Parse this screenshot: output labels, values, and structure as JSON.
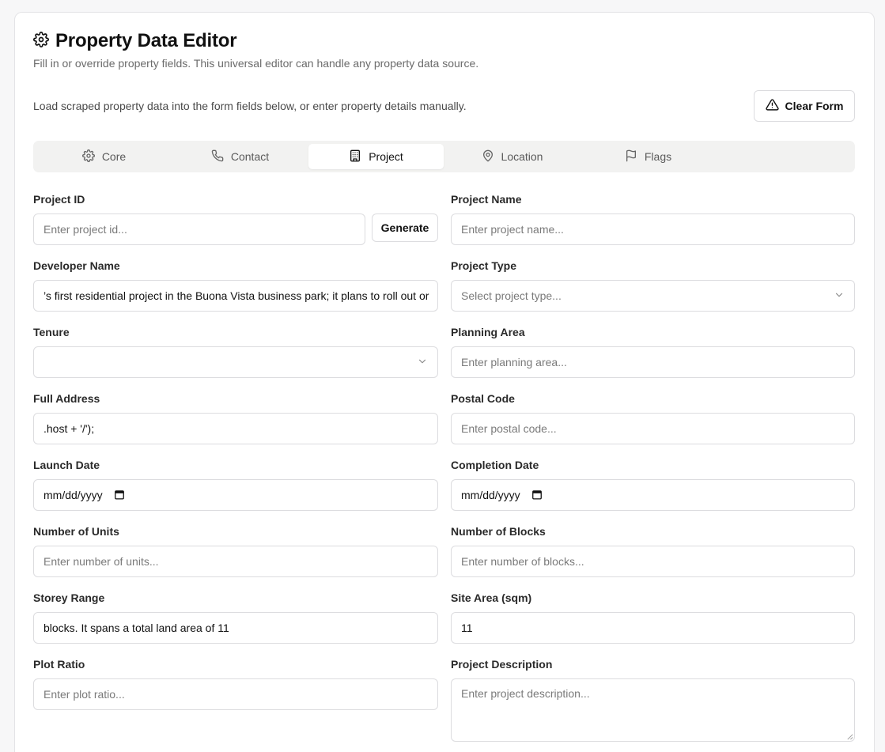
{
  "header": {
    "title": "Property Data Editor",
    "subtitle": "Fill in or override property fields. This universal editor can handle any property data source.",
    "load_text": "Load scraped property data into the form fields below, or enter property details manually.",
    "clear_label": "Clear Form"
  },
  "tabs": [
    {
      "label": "Core",
      "icon": "gear-icon",
      "active": false
    },
    {
      "label": "Contact",
      "icon": "phone-icon",
      "active": false
    },
    {
      "label": "Project",
      "icon": "building-icon",
      "active": true
    },
    {
      "label": "Location",
      "icon": "map-pin-icon",
      "active": false
    },
    {
      "label": "Flags",
      "icon": "flag-icon",
      "active": false
    }
  ],
  "form": {
    "project_id": {
      "label": "Project ID",
      "placeholder": "Enter project id...",
      "generate_label": "Generate"
    },
    "project_name": {
      "label": "Project Name",
      "placeholder": "Enter project name..."
    },
    "developer_name": {
      "label": "Developer Name",
      "value": "’s first residential project in the Buona Vista business park; it plans to roll out or"
    },
    "project_type": {
      "label": "Project Type",
      "placeholder": "Select project type..."
    },
    "tenure": {
      "label": "Tenure",
      "value": ""
    },
    "planning_area": {
      "label": "Planning Area",
      "placeholder": "Enter planning area..."
    },
    "full_address": {
      "label": "Full Address",
      "value": ".host + '/');"
    },
    "postal_code": {
      "label": "Postal Code",
      "placeholder": "Enter postal code..."
    },
    "launch_date": {
      "label": "Launch Date",
      "value": "mm/dd/yyyy"
    },
    "completion_date": {
      "label": "Completion Date",
      "value": "mm/dd/yyyy"
    },
    "num_units": {
      "label": "Number of Units",
      "placeholder": "Enter number of units..."
    },
    "num_blocks": {
      "label": "Number of Blocks",
      "placeholder": "Enter number of blocks..."
    },
    "storey_range": {
      "label": "Storey Range",
      "value": "blocks. It spans a total land area of 11"
    },
    "site_area": {
      "label": "Site Area (sqm)",
      "value": "11"
    },
    "plot_ratio": {
      "label": "Plot Ratio",
      "placeholder": "Enter plot ratio..."
    },
    "project_description": {
      "label": "Project Description",
      "placeholder": "Enter project description..."
    }
  },
  "colors": {
    "accent": "#111111",
    "border": "#dcdcdf",
    "tab_bg": "#f2f2f1"
  }
}
